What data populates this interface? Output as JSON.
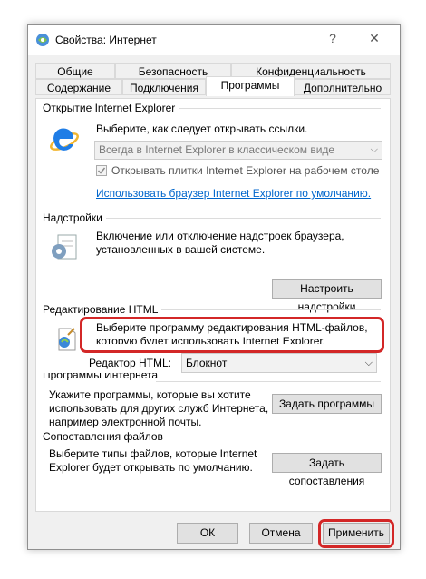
{
  "window": {
    "title": "Свойства: Интернет",
    "help_glyph": "?",
    "close_glyph": "✕"
  },
  "tabs": {
    "row1": [
      "Общие",
      "Безопасность",
      "Конфиденциальность"
    ],
    "row2": [
      "Содержание",
      "Подключения",
      "Программы",
      "Дополнительно"
    ],
    "active": "Программы"
  },
  "open_ie": {
    "title": "Открытие Internet Explorer",
    "description": "Выберите, как следует открывать ссылки.",
    "combo_value": "Всегда в Internet Explorer в классическом виде",
    "checkbox_label": "Открывать плитки Internet Explorer на рабочем столе",
    "checkbox_checked": true,
    "default_link": "Использовать браузер Internet Explorer по умолчанию."
  },
  "addons": {
    "title": "Надстройки",
    "description_line1": "Включение или отключение надстроек браузера,",
    "description_line2": "установленных в вашей системе.",
    "button": "Настроить надстройки"
  },
  "html_edit": {
    "title": "Редактирование HTML",
    "description_line1": "Выберите программу редактирования HTML-файлов,",
    "description_line2": "которую будет использовать Internet Explorer.",
    "editor_label": "Редактор HTML:",
    "editor_value": "Блокнот"
  },
  "internet_programs": {
    "title": "Программы Интернета",
    "description_line1": "Укажите программы, которые вы хотите",
    "description_line2": "использовать для других служб Интернета,",
    "description_line3": "например электронной почты.",
    "button": "Задать программы"
  },
  "file_assoc": {
    "title": "Сопоставления файлов",
    "description_line1": "Выберите типы файлов, которые Internet",
    "description_line2": "Explorer будет открывать по умолчанию.",
    "button": "Задать сопоставления"
  },
  "footer": {
    "ok": "ОК",
    "cancel": "Отмена",
    "apply": "Применить"
  },
  "colors": {
    "highlight": "#d32727",
    "link": "#0066cc",
    "dialog_bg": "#f0f0f0"
  }
}
